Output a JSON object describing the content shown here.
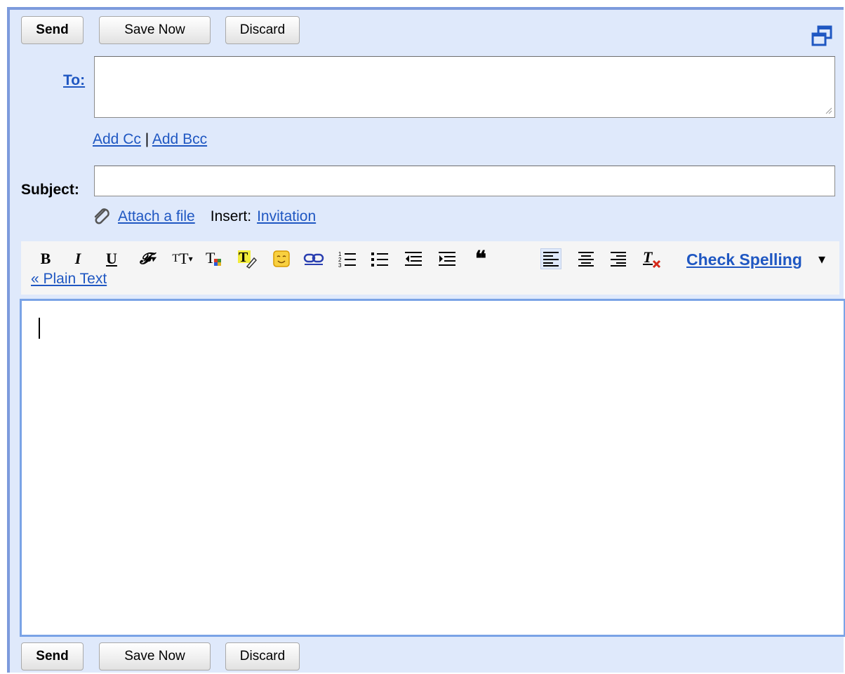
{
  "top_buttons": {
    "send": "Send",
    "save_now": "Save Now",
    "discard": "Discard"
  },
  "bottom_buttons": {
    "send": "Send",
    "save_now": "Save Now",
    "discard": "Discard"
  },
  "to": {
    "label": "To:",
    "value": ""
  },
  "links": {
    "add_cc": "Add Cc",
    "separator": "|",
    "add_bcc": "Add Bcc",
    "attach_file": "Attach a file",
    "insert_label": "Insert:",
    "invitation": "Invitation",
    "plain_text": "« Plain Text"
  },
  "subject": {
    "label": "Subject:",
    "value": ""
  },
  "toolbar": {
    "icons": [
      "bold-icon",
      "italic-icon",
      "underline-icon",
      "font-icon",
      "font-size-icon",
      "text-color-icon",
      "highlight-color-icon",
      "emoticon-icon",
      "link-icon",
      "numbered-list-icon",
      "bulleted-list-icon",
      "indent-less-icon",
      "indent-more-icon",
      "quote-icon",
      "align-left-icon",
      "align-center-icon",
      "align-right-icon",
      "remove-formatting-icon"
    ],
    "check_spelling": "Check Spelling",
    "dropdown_arrow": "▾"
  },
  "body": {
    "value": ""
  },
  "colors": {
    "panel_bg": "#dfe9fb",
    "panel_border": "#7d9bdc",
    "link": "#1f57c2",
    "editor_border": "#7aa3e6"
  }
}
